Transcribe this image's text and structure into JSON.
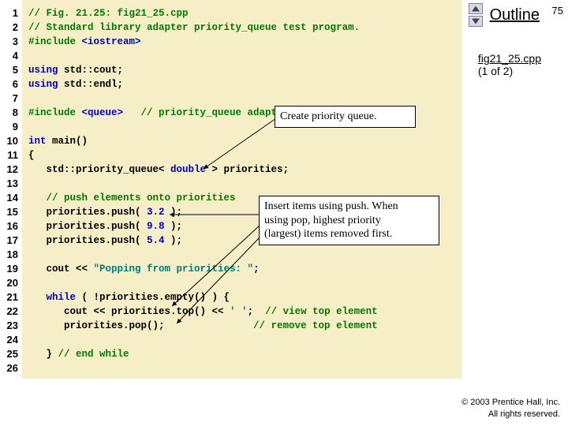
{
  "slide_number": "75",
  "outline_title": "Outline",
  "file_info": {
    "name": "fig21_25.cpp",
    "part": "(1 of 2)"
  },
  "copyright": {
    "line1": "© 2003 Prentice Hall, Inc.",
    "line2": "All rights reserved."
  },
  "line_numbers": [
    "1",
    "2",
    "3",
    "4",
    "5",
    "6",
    "7",
    "8",
    "9",
    "10",
    "11",
    "12",
    "13",
    "14",
    "15",
    "16",
    "17",
    "18",
    "19",
    "20",
    "21",
    "22",
    "23",
    "24",
    "25",
    "26"
  ],
  "code": {
    "l1a": "// Fig. 21.25: fig21_25.cpp",
    "l2a": "// Standard library adapter priority_queue test program.",
    "l3a": "#include",
    "l3b": " <iostream>",
    "l5a": "using",
    "l5b": " std::cout;",
    "l6a": "using",
    "l6b": " std::endl;",
    "l8a": "#include",
    "l8b": " <queue>   ",
    "l8c": "// priority_queue adapter definition",
    "l10a": "int",
    "l10b": " main()",
    "l11a": "{",
    "l12a": "   std::priority_queue< ",
    "l12b": "double",
    "l12c": " > priorities;",
    "l14a": "   ",
    "l14b": "// push elements onto priorities",
    "l15a": "   priorities.push( ",
    "l15b": "3.2",
    "l15c": " );",
    "l16a": "   priorities.push( ",
    "l16b": "9.8",
    "l16c": " );",
    "l17a": "   priorities.push( ",
    "l17b": "5.4",
    "l17c": " );",
    "l19a": "   cout << ",
    "l19b": "\"Popping from priorities: \"",
    "l19c": ";",
    "l21a": "   ",
    "l21b": "while",
    "l21c": " ( !priorities.empty() ) {",
    "l22a": "      cout << priorities.top() << ",
    "l22b": "' '",
    "l22c": ";  ",
    "l22d": "// view top element",
    "l23a": "      priorities.pop();               ",
    "l23b": "// remove top element",
    "l25a": "   } ",
    "l25b": "// end while"
  },
  "callouts": {
    "c1": "Create priority queue.",
    "c2_l1": "Insert items using push. When",
    "c2_l2": "using pop, highest priority",
    "c2_l3": "(largest) items removed first."
  }
}
